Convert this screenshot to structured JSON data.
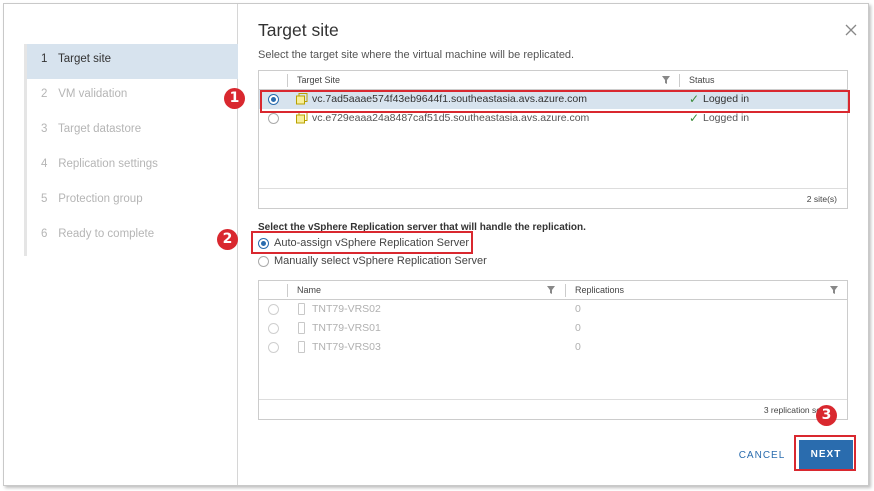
{
  "wizard": {
    "steps": [
      {
        "num": "1",
        "label": "Target site"
      },
      {
        "num": "2",
        "label": "VM validation"
      },
      {
        "num": "3",
        "label": "Target datastore"
      },
      {
        "num": "4",
        "label": "Replication settings"
      },
      {
        "num": "5",
        "label": "Protection group"
      },
      {
        "num": "6",
        "label": "Ready to complete"
      }
    ]
  },
  "main": {
    "title": "Target site",
    "subtitle": "Select the target site where the virtual machine will be replicated."
  },
  "sites_grid": {
    "headers": {
      "site": "Target Site",
      "status": "Status"
    },
    "rows": [
      {
        "site": "vc.7ad5aaae574f43eb9644f1.southeastasia.avs.azure.com",
        "status": "Logged in",
        "selected": true
      },
      {
        "site": "vc.e729eaaa24a8487caf51d5.southeastasia.avs.azure.com",
        "status": "Logged in",
        "selected": false
      }
    ],
    "footer": "2 site(s)"
  },
  "replication": {
    "label": "Select the vSphere Replication server that will handle the replication.",
    "option_auto": "Auto-assign vSphere Replication Server",
    "option_manual": "Manually select vSphere Replication Server"
  },
  "servers_grid": {
    "headers": {
      "name": "Name",
      "replications": "Replications"
    },
    "rows": [
      {
        "name": "TNT79-VRS02",
        "replications": "0"
      },
      {
        "name": "TNT79-VRS01",
        "replications": "0"
      },
      {
        "name": "TNT79-VRS03",
        "replications": "0"
      }
    ],
    "footer": "3 replication se"
  },
  "buttons": {
    "cancel": "CANCEL",
    "next": "NEXT"
  },
  "callouts": {
    "one": "1",
    "two": "2",
    "three": "3"
  },
  "colors": {
    "accent": "#2a6cae",
    "callout": "#d9282f",
    "selected_row": "#d7e3ee",
    "ok": "#3c8c3c"
  },
  "icons": {
    "close": "close-icon",
    "filter": "filter-icon",
    "site": "site-icon",
    "check": "check-icon",
    "server": "server-icon"
  }
}
